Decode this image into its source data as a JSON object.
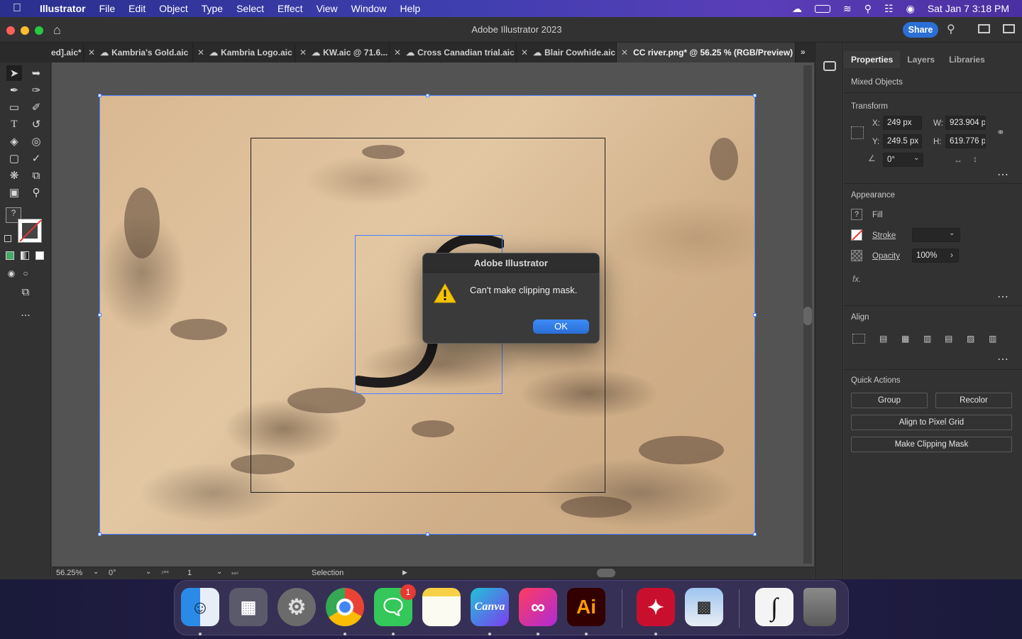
{
  "menubar": {
    "app_name": "Illustrator",
    "menus": [
      "File",
      "Edit",
      "Object",
      "Type",
      "Select",
      "Effect",
      "View",
      "Window",
      "Help"
    ],
    "datetime": "Sat Jan 7  3:18 PM"
  },
  "titlebar": {
    "title": "Adobe Illustrator 2023",
    "share_label": "Share"
  },
  "tabs": [
    {
      "label": "ed].aic*",
      "active": false
    },
    {
      "label": "Kambria's Gold.aic",
      "active": false
    },
    {
      "label": "Kambria Logo.aic",
      "active": false
    },
    {
      "label": "KW.aic @ 71.6...",
      "active": false
    },
    {
      "label": "Cross Canadian trial.aic",
      "active": false
    },
    {
      "label": "Blair Cowhide.aic",
      "active": false
    },
    {
      "label": "CC river.png* @ 56.25 % (RGB/Preview)",
      "active": true
    }
  ],
  "tools": {
    "more": "..."
  },
  "dialog": {
    "title": "Adobe Illustrator",
    "message": "Can't make clipping mask.",
    "ok_label": "OK"
  },
  "statusbar": {
    "zoom": "56.25%",
    "rotation": "0°",
    "artboard": "1",
    "tool": "Selection"
  },
  "panel": {
    "tabs": [
      "Properties",
      "Layers",
      "Libraries"
    ],
    "object_type": "Mixed Objects",
    "transform": {
      "heading": "Transform",
      "x_label": "X:",
      "x": "249 px",
      "y_label": "Y:",
      "y": "249.5 px",
      "w_label": "W:",
      "w": "923.904 p",
      "h_label": "H:",
      "h": "619.776 p",
      "angle": "0°"
    },
    "appearance": {
      "heading": "Appearance",
      "fill_label": "Fill",
      "fill_swatch": "?",
      "stroke_label": "Stroke",
      "opacity_label": "Opacity",
      "opacity": "100%",
      "fx": "fx."
    },
    "align": {
      "heading": "Align"
    },
    "quick_actions": {
      "heading": "Quick Actions",
      "group": "Group",
      "recolor": "Recolor",
      "align_pixel": "Align to Pixel Grid",
      "clip_mask": "Make Clipping Mask"
    }
  },
  "dock": {
    "canva": "Canva",
    "ai": "Ai",
    "messages_badge": "1"
  },
  "colors": {
    "accent": "#2b6fd6",
    "selection": "#4a7fff"
  }
}
